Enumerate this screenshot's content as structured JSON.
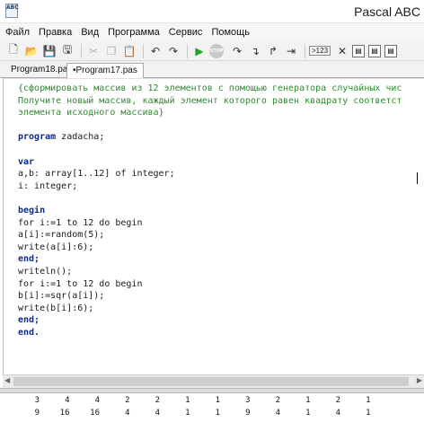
{
  "window": {
    "title": "Pascal ABC",
    "app_icon_text": "ABC"
  },
  "menu": [
    "Файл",
    "Правка",
    "Вид",
    "Программа",
    "Сервис",
    "Помощь"
  ],
  "toolbar": {
    "icons": [
      "new-file-icon",
      "open-folder-icon",
      "save-icon",
      "save-all-icon",
      "cut-icon",
      "copy-icon",
      "paste-icon",
      "undo-icon",
      "redo-icon",
      "run-icon",
      "stop-icon",
      "step-over-icon",
      "step-into-icon",
      "step-out-icon",
      "goto-cursor-icon",
      "output-icon",
      "clear-icon",
      "option-icon"
    ],
    "stop_label": "STOP",
    "output_label": ">123"
  },
  "tabs": [
    {
      "label": "Program18.pas",
      "active": false
    },
    {
      "label": "•Program17.pas",
      "active": true
    }
  ],
  "editor": {
    "lines": [
      {
        "text": "{сформировать массив из 12 элементов с помощью генератора случайных чис",
        "style": "comment"
      },
      {
        "text": "Получите новый массив, каждый элемент которого равен квадрату соответст",
        "style": "comment"
      },
      {
        "text": "элемента исходного массива}",
        "style": "comment"
      },
      {
        "text": "",
        "style": "plain"
      },
      {
        "text": "program zadacha;",
        "style": "plain",
        "keyword": "program"
      },
      {
        "text": "",
        "style": "plain"
      },
      {
        "text": "var",
        "style": "keyword"
      },
      {
        "text": "a,b: array[1..12] of integer;",
        "style": "plain"
      },
      {
        "text": "i: integer;",
        "style": "plain"
      },
      {
        "text": "",
        "style": "plain"
      },
      {
        "text": "begin",
        "style": "keyword"
      },
      {
        "text": "for i:=1 to 12 do begin",
        "style": "plain"
      },
      {
        "text": "a[i]:=random(5);",
        "style": "plain"
      },
      {
        "text": "write(a[i]:6);",
        "style": "plain"
      },
      {
        "text": "end;",
        "style": "keyword"
      },
      {
        "text": "writeln();",
        "style": "plain"
      },
      {
        "text": "for i:=1 to 12 do begin",
        "style": "plain"
      },
      {
        "text": "b[i]:=sqr(a[i]);",
        "style": "plain"
      },
      {
        "text": "write(b[i]:6);",
        "style": "plain"
      },
      {
        "text": "end;",
        "style": "keyword"
      },
      {
        "text": "end.",
        "style": "keyword"
      }
    ]
  },
  "output": {
    "rows": [
      [
        "3",
        "4",
        "4",
        "2",
        "2",
        "1",
        "1",
        "3",
        "2",
        "1",
        "2",
        "1"
      ],
      [
        "9",
        "16",
        "16",
        "4",
        "4",
        "1",
        "1",
        "9",
        "4",
        "1",
        "4",
        "1"
      ]
    ]
  },
  "colors": {
    "comment": "#2f8a2f",
    "keyword": "#0d2b8f",
    "run_green": "#2e9e2e"
  }
}
